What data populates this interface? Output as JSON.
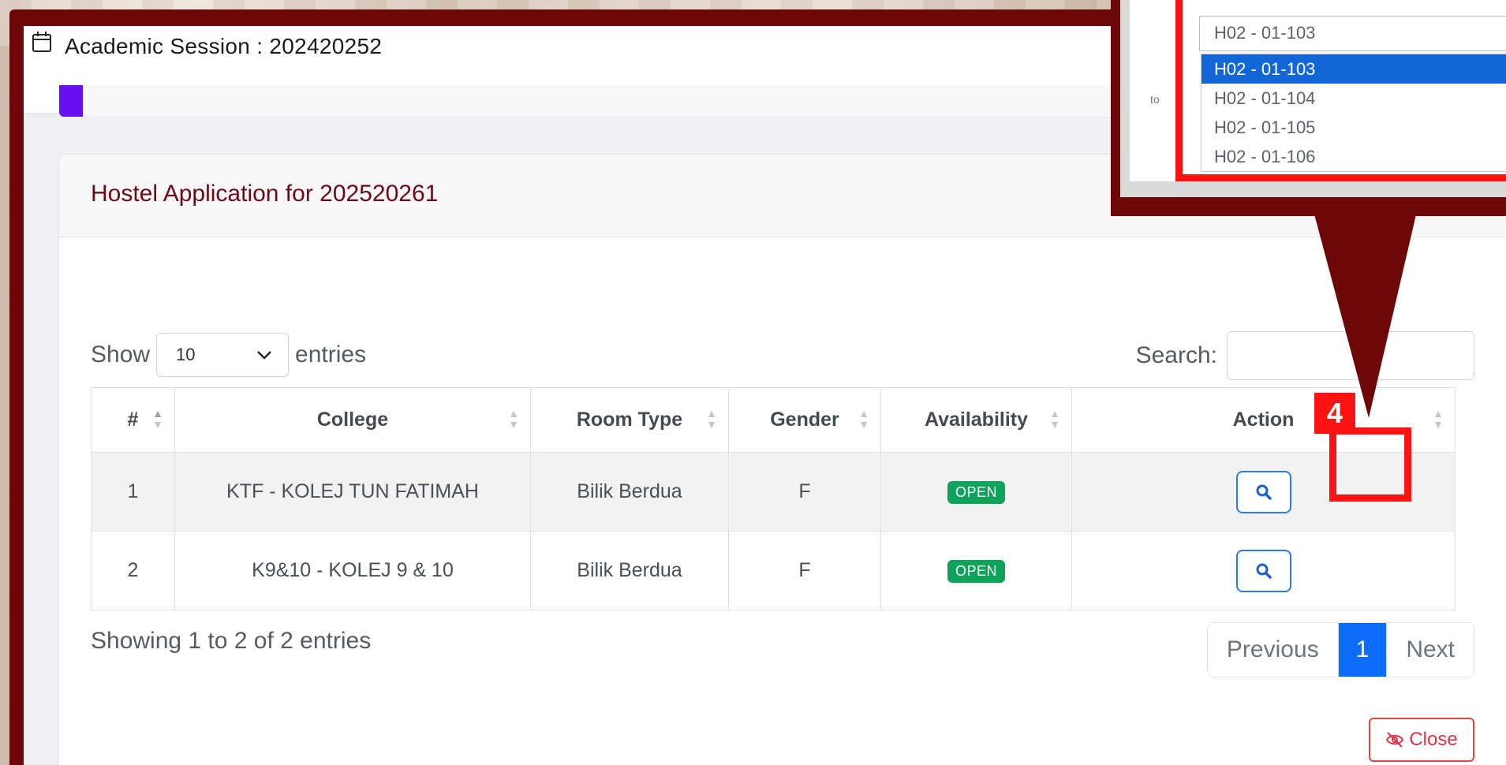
{
  "session": {
    "label": "Academic Session : 202420252",
    "icon": "calendar-icon"
  },
  "hostel": {
    "title": "Hostel Application for 202520261",
    "show_label": "Show",
    "entries_label": "entries",
    "page_length": "10",
    "search_label": "Search:",
    "search_value": "",
    "columns": [
      "#",
      "College",
      "Room Type",
      "Gender",
      "Availability",
      "Action"
    ],
    "rows": [
      {
        "no": "1",
        "college": "KTF - KOLEJ TUN FATIMAH",
        "room_type": "Bilik Berdua",
        "gender": "F",
        "availability": "OPEN"
      },
      {
        "no": "2",
        "college": "K9&10 - KOLEJ 9 & 10",
        "room_type": "Bilik Berdua",
        "gender": "F",
        "availability": "OPEN"
      }
    ],
    "info": "Showing 1 to 2 of 2 entries",
    "pager": {
      "previous": "Previous",
      "current": "1",
      "next": "Next"
    },
    "close_label": "Close"
  },
  "annotation": {
    "step": "4"
  },
  "callout": {
    "field_value": "H02 - 01-103",
    "options": [
      "H02 - 01-103",
      "H02 - 01-104",
      "H02 - 01-105",
      "H02 - 01-106"
    ],
    "selected_index": 0,
    "side_text": "to"
  },
  "colors": {
    "frame": "#6e0707",
    "highlight": "#ff1212",
    "accent_purple": "#6610f2",
    "primary": "#0d6efd",
    "success": "#0ea35a",
    "danger": "#dc3545",
    "title": "#6e0a16"
  }
}
